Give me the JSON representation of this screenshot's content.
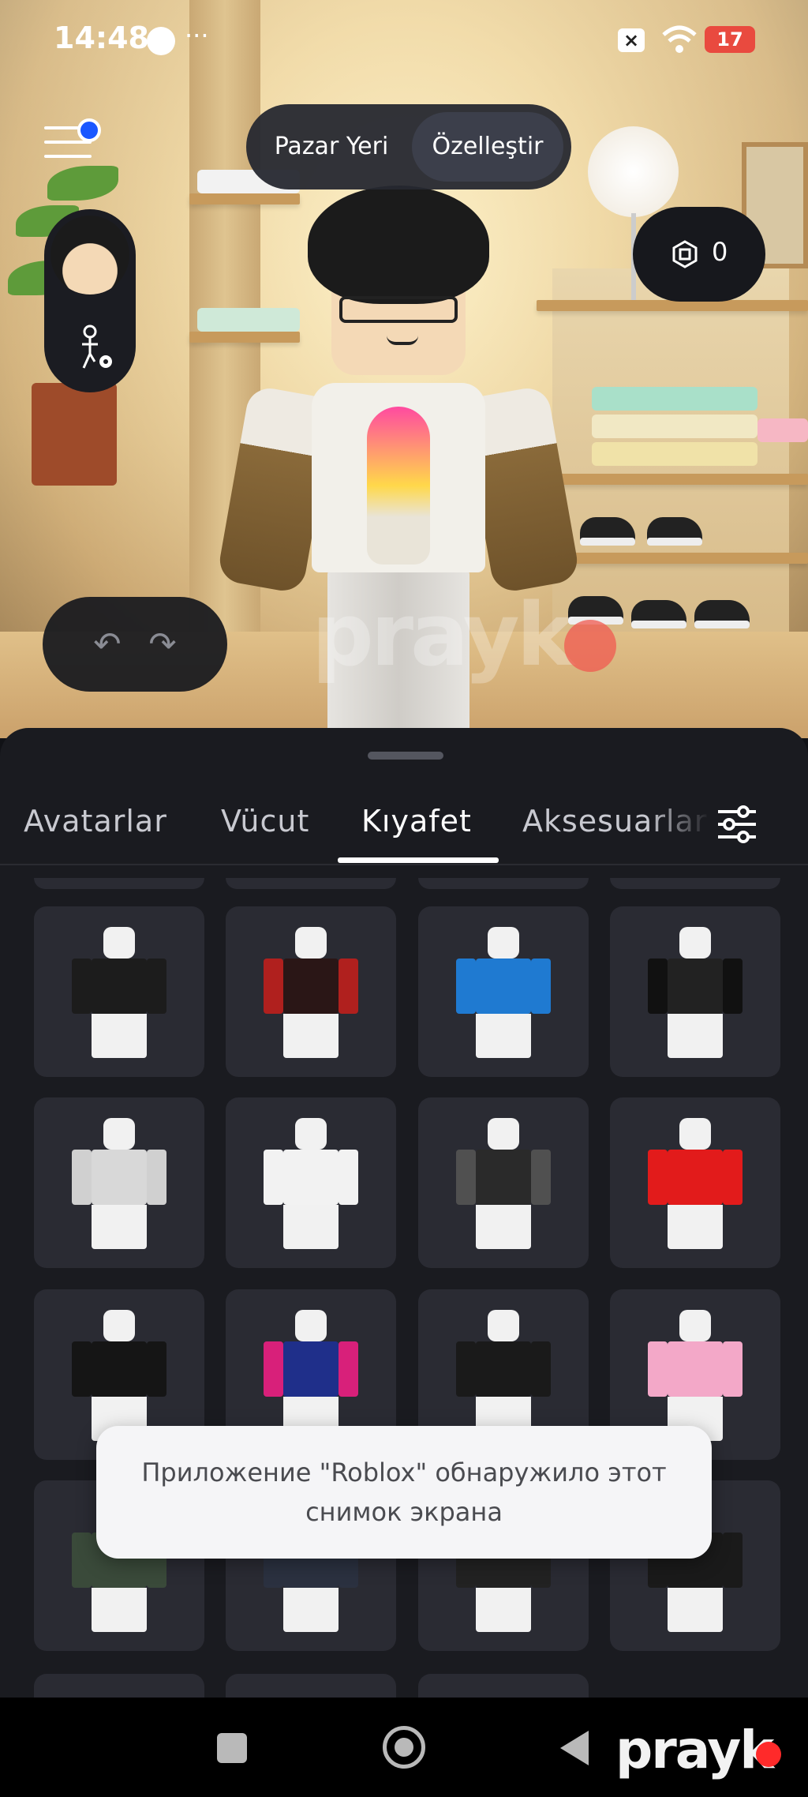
{
  "status_bar": {
    "time": "14:48",
    "more": "···",
    "battery": "17"
  },
  "header": {
    "mode_tabs": [
      {
        "label": "Pazar Yeri",
        "active": false
      },
      {
        "label": "Özelleştir",
        "active": true
      }
    ],
    "robux_balance": "0",
    "undo_icon": "undo-icon",
    "redo_icon": "redo-icon"
  },
  "category_tabs": [
    {
      "label": "Avatarlar",
      "active": false
    },
    {
      "label": "Vücut",
      "active": false
    },
    {
      "label": "Kıyafet",
      "active": true
    },
    {
      "label": "Aksesuarlar",
      "active": false
    }
  ],
  "items": [
    {
      "name": "shirt-black-floral",
      "torso": "#1c1c1c",
      "arms": "#1c1c1c"
    },
    {
      "name": "shirt-spider",
      "torso": "#2a1616",
      "arms": "#b0201e"
    },
    {
      "name": "shirt-blue",
      "torso": "#1f7ad1",
      "arms": "#1f7ad1"
    },
    {
      "name": "shirt-black-skull",
      "torso": "#222",
      "arms": "#111"
    },
    {
      "name": "shirt-white-tie",
      "torso": "#d8d8d8",
      "arms": "#d0d0d0"
    },
    {
      "name": "shirt-white-jersey",
      "torso": "#f2f2f2",
      "arms": "#f2f2f2"
    },
    {
      "name": "shirt-black-suit",
      "torso": "#2a2a2a",
      "arms": "#505050"
    },
    {
      "name": "shirt-red",
      "torso": "#e21b1b",
      "arms": "#e21b1b"
    },
    {
      "name": "shirt-black-tux",
      "torso": "#151515",
      "arms": "#151515"
    },
    {
      "name": "shirt-blue-pink",
      "torso": "#1f2f8a",
      "arms": "#d8207a"
    },
    {
      "name": "shirt-black-graphic",
      "torso": "#1a1a1a",
      "arms": "#1a1a1a"
    },
    {
      "name": "shirt-pink-kitty",
      "torso": "#f3a8c8",
      "arms": "#f3a8c8"
    },
    {
      "name": "shirt-plaid",
      "torso": "#3a4a3a",
      "arms": "#3a4a3a"
    },
    {
      "name": "shirt-denim",
      "torso": "#2b3140",
      "arms": "#2b3140"
    },
    {
      "name": "shirt-black-aig",
      "torso": "#222",
      "arms": "#222"
    },
    {
      "name": "shirt-black-plain",
      "torso": "#1a1a1a",
      "arms": "#1a1a1a"
    }
  ],
  "toast": {
    "message": "Приложение \"Roblox\" обнаружило этот снимок экрана"
  },
  "watermark": "prayk",
  "colors": {
    "panel": "#1a1b20",
    "tile": "#2a2b33",
    "notification_dot": "#1a57ff",
    "battery": "#e94a3f"
  }
}
